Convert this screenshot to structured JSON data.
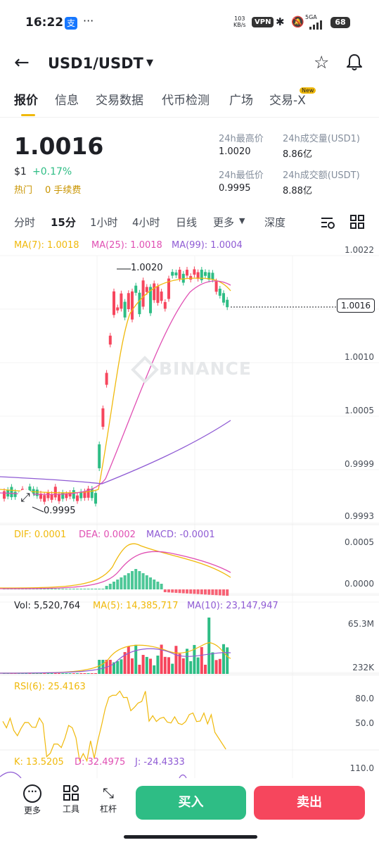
{
  "status": {
    "time": "16:22",
    "alipay": "支",
    "dots": "···",
    "speed_top": "103",
    "speed_unit": "KB/s",
    "vpn": "VPN",
    "net": "5GA",
    "battery": "68"
  },
  "header": {
    "pair": "USD1/USDT",
    "caret": "▼"
  },
  "tabs": [
    {
      "label": "报价"
    },
    {
      "label": "信息"
    },
    {
      "label": "交易数据"
    },
    {
      "label": "代币检测"
    },
    {
      "label": "广场"
    },
    {
      "label": "交易-X"
    }
  ],
  "tab_new": "New",
  "quote": {
    "price": "1.0016",
    "usd": "$1",
    "change": "+0.17%",
    "hot": "热门",
    "fee": "0 手续费",
    "high_label": "24h最高价",
    "high": "1.0020",
    "low_label": "24h最低价",
    "low": "0.9995",
    "vol_label": "24h成交量(USD1)",
    "vol": "8.86亿",
    "amt_label": "24h成交额(USDT)",
    "amt": "8.88亿"
  },
  "intervals": [
    {
      "label": "分时"
    },
    {
      "label": "15分"
    },
    {
      "label": "1小时"
    },
    {
      "label": "4小时"
    },
    {
      "label": "日线"
    },
    {
      "label": "更多"
    },
    {
      "label": "深度"
    }
  ],
  "indicators": {
    "ma7": "MA(7): 1.0018",
    "ma25": "MA(25): 1.0018",
    "ma99": "MA(99): 1.0004",
    "dif": "DIF: 0.0001",
    "dea": "DEA: 0.0002",
    "macd": "MACD: -0.0001",
    "vol": "Vol: 5,520,764",
    "vma5": "MA(5): 14,385,717",
    "vma10": "MA(10): 23,147,947",
    "rsi": "RSI(6): 25.4163",
    "k": "K: 13.5205",
    "d": "D: 32.4975",
    "j": "J: -24.4333"
  },
  "axes": {
    "price": [
      "1.0022",
      "1.0010",
      "1.0005",
      "0.9999",
      "0.9993"
    ],
    "current": "1.0016",
    "macd": [
      "0.0005",
      "0.0000"
    ],
    "vol": [
      "65.3M",
      "232K"
    ],
    "rsi": [
      "80.0",
      "50.0"
    ],
    "kdj": [
      "110.0"
    ]
  },
  "annotations": {
    "high": "1.0020",
    "low": "0.9995",
    "watermark": "BINANCE"
  },
  "colors": {
    "up": "#2ebd85",
    "down": "#f6465d",
    "accent": "#f0b90b",
    "ma7": "#f0b90b",
    "ma25": "#e04fb3",
    "ma99": "#8f5bd4"
  },
  "bottom": {
    "more": "更多",
    "tools": "工具",
    "leverage": "杠杆",
    "buy": "买入",
    "sell": "卖出"
  }
}
